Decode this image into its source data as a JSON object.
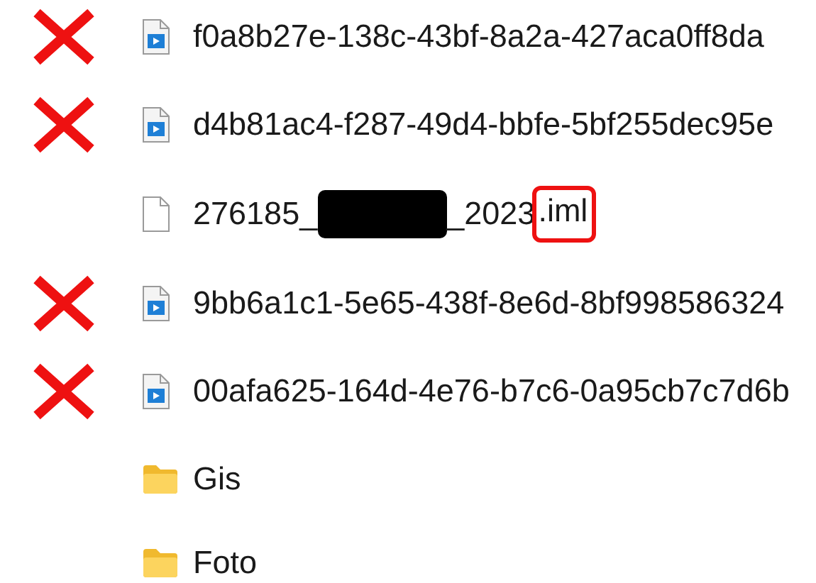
{
  "files": [
    {
      "kind": "video-file",
      "name": "f0a8b27e-138c-43bf-8a2a-427aca0ff8da",
      "crossed": true
    },
    {
      "kind": "video-file",
      "name": "d4b81ac4-f287-49d4-bbfe-5bf255dec95e",
      "crossed": true
    },
    {
      "kind": "file",
      "name": "276185_",
      "redacted": true,
      "name_after": "_2023",
      "extension": ".iml",
      "extension_circled": true,
      "crossed": false
    },
    {
      "kind": "video-file",
      "name": "9bb6a1c1-5e65-438f-8e6d-8bf998586324",
      "crossed": true
    },
    {
      "kind": "video-file",
      "name": "00afa625-164d-4e76-b7c6-0a95cb7c7d6b",
      "crossed": true
    },
    {
      "kind": "folder",
      "name": "Gis",
      "crossed": false
    },
    {
      "kind": "folder",
      "name": "Foto",
      "crossed": false
    }
  ]
}
